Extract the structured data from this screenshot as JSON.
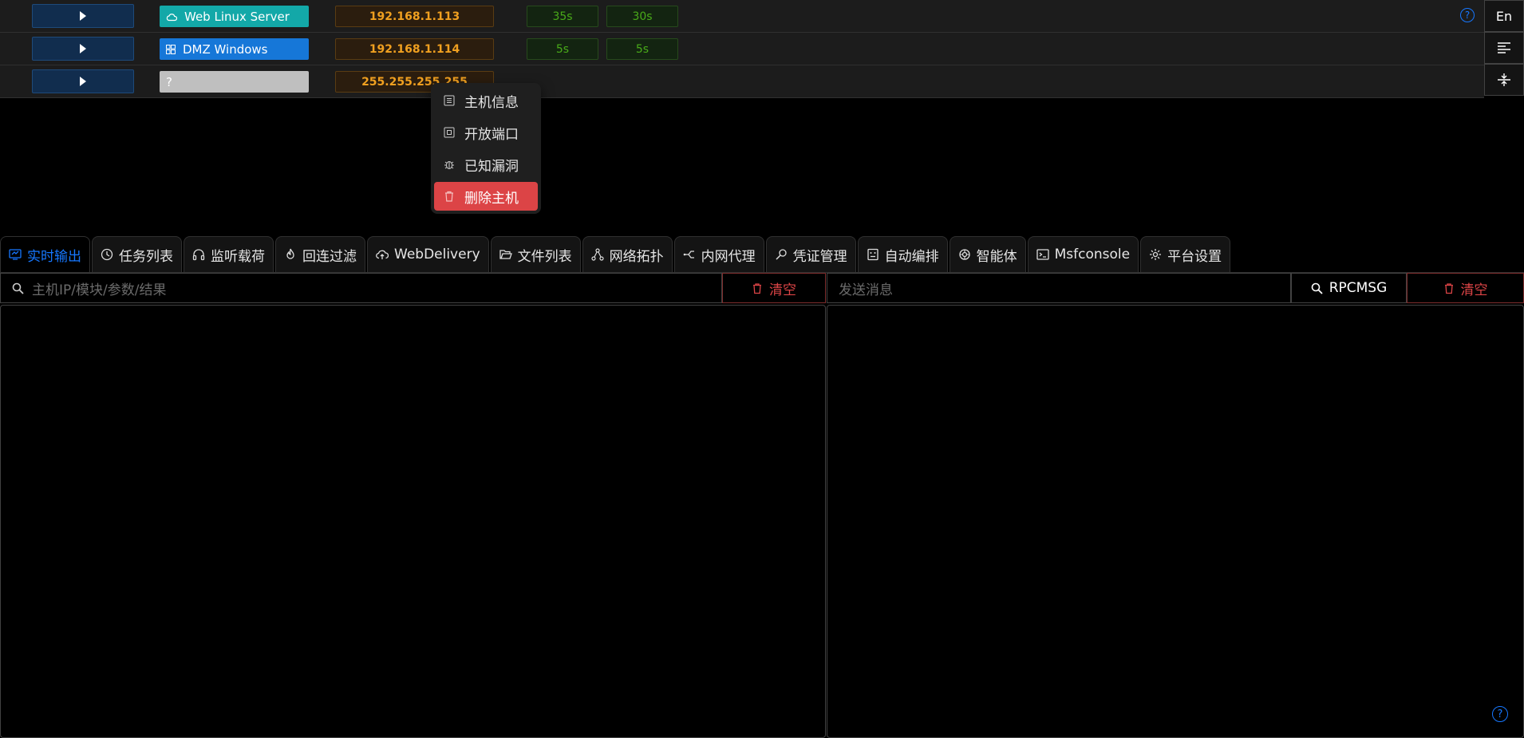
{
  "hosts": [
    {
      "os_label": "Web Linux Server",
      "os_icon": "cloud-icon",
      "ip": "192.168.1.113",
      "time1": "35s",
      "time2": "30s"
    },
    {
      "os_label": "DMZ Windows",
      "os_icon": "windows-icon",
      "ip": "192.168.1.114",
      "time1": "5s",
      "time2": "5s"
    },
    {
      "os_label": "?",
      "os_icon": "unknown-icon",
      "ip": "255.255.255.255"
    }
  ],
  "side_buttons": {
    "lang": "En"
  },
  "context_menu": {
    "items": [
      {
        "label": "主机信息",
        "icon": "info-icon"
      },
      {
        "label": "开放端口",
        "icon": "port-icon"
      },
      {
        "label": "已知漏洞",
        "icon": "bug-icon"
      },
      {
        "label": "删除主机",
        "icon": "trash-icon"
      }
    ]
  },
  "tabs": [
    {
      "label": "实时输出",
      "icon": "monitor-icon",
      "active": true
    },
    {
      "label": "任务列表",
      "icon": "clock-icon"
    },
    {
      "label": "监听载荷",
      "icon": "headphones-icon"
    },
    {
      "label": "回连过滤",
      "icon": "fire-icon"
    },
    {
      "label": "WebDelivery",
      "icon": "cloud-upload-icon"
    },
    {
      "label": "文件列表",
      "icon": "folder-icon"
    },
    {
      "label": "网络拓扑",
      "icon": "topology-icon"
    },
    {
      "label": "内网代理",
      "icon": "proxy-icon"
    },
    {
      "label": "凭证管理",
      "icon": "key-icon"
    },
    {
      "label": "自动编排",
      "icon": "robot-icon"
    },
    {
      "label": "智能体",
      "icon": "ai-icon"
    },
    {
      "label": "Msfconsole",
      "icon": "terminal-icon"
    },
    {
      "label": "平台设置",
      "icon": "settings-icon"
    }
  ],
  "search": {
    "placeholder": "主机IP/模块/参数/结果",
    "clear_label": "清空"
  },
  "message": {
    "placeholder": "发送消息",
    "rpc_label": "RPCMSG",
    "clear_label": "清空"
  },
  "colors": {
    "accent": "#1677ff",
    "danger": "#dc4446",
    "ip": "#f0a020",
    "time": "#49aa19",
    "linux": "#13a8a8",
    "windows": "#1677d8"
  }
}
